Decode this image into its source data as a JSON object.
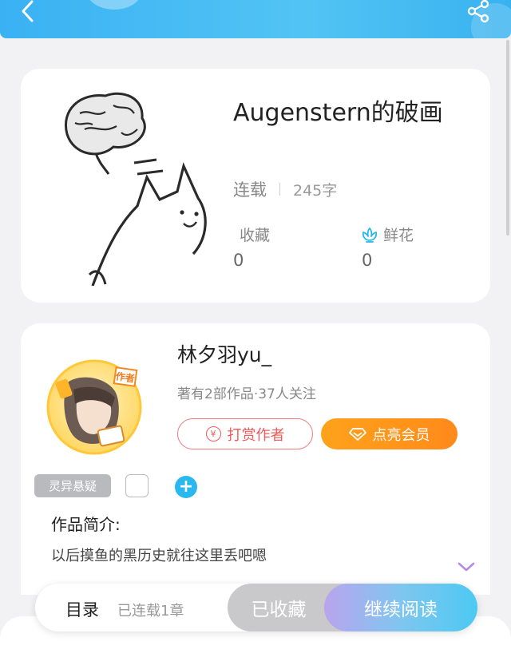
{
  "header": {
    "back_icon": "chevron-left-icon",
    "share_icon": "share-icon",
    "accent": "#3ab1f3"
  },
  "book": {
    "title": "Augenstern的破画",
    "status": "连载",
    "word_count": "245字",
    "favorites_label": "收藏",
    "favorites_value": "0",
    "flowers_label": "鲜花",
    "flowers_value": "0",
    "flower_icon": "flower-icon"
  },
  "author": {
    "name": "林夕羽yu_",
    "meta": "著有2部作品·37人关注",
    "badge_text": "作者",
    "tip_label": "打赏作者",
    "vip_label": "点亮会员"
  },
  "tags": {
    "items": [
      "灵异悬疑"
    ],
    "add_label": "+"
  },
  "intro": {
    "label": "作品简介:",
    "text": "以后摸鱼的黑历史就往这里丢吧嗯"
  },
  "bottom": {
    "toc_label": "目录",
    "toc_sub": "已连载1章",
    "collected_label": "已收藏",
    "read_label": "继续阅读"
  }
}
